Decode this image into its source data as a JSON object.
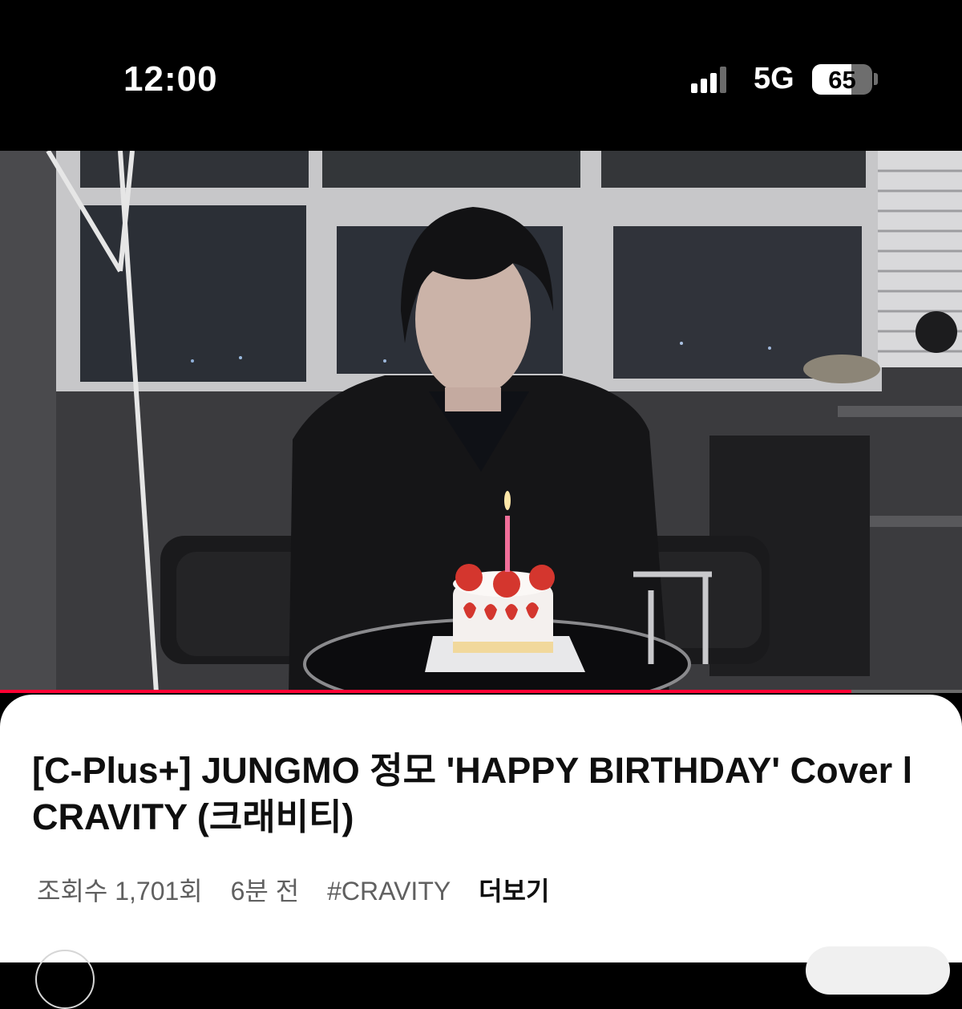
{
  "status_bar": {
    "time": "12:00",
    "network": "5G",
    "battery": "65",
    "battery_level": 0.65,
    "signal_bars": 3,
    "signal_icon": "cellular-signal-icon",
    "battery_icon": "battery-icon"
  },
  "video": {
    "progress_fraction": 0.885,
    "progress_color": "#ff0033"
  },
  "info": {
    "title": "[C-Plus+] JUNGMO 정모 'HAPPY BIRTHDAY' Cover l CRAVITY (크래비티)",
    "views": "조회수 1,701회",
    "age": "6분 전",
    "hashtag": "#CRAVITY",
    "more": "더보기"
  }
}
